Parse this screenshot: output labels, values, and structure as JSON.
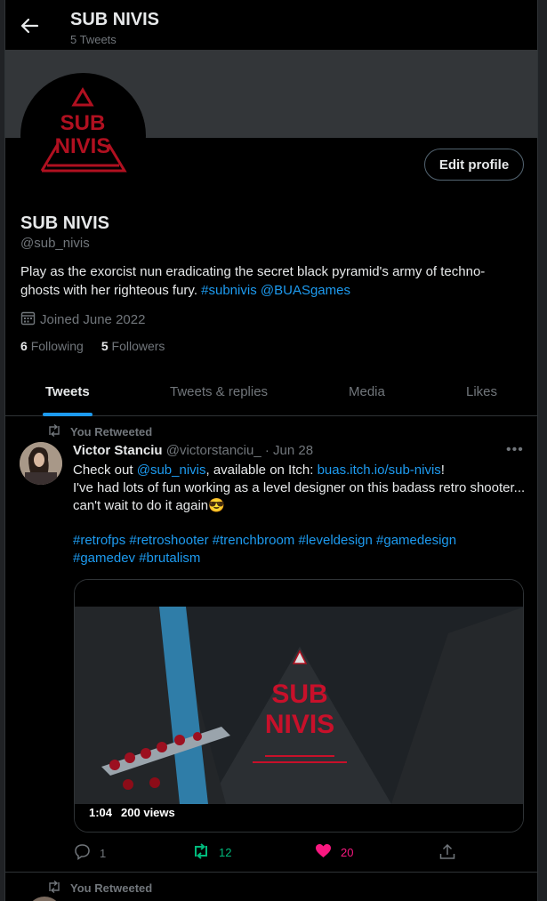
{
  "header": {
    "title": "SUB NIVIS",
    "subtitle": "5 Tweets"
  },
  "profile": {
    "avatar_text_line1": "SUB",
    "avatar_text_line2": "NIVIS",
    "edit_label": "Edit profile",
    "name": "SUB NIVIS",
    "handle": "@sub_nivis",
    "bio_text": "Play as the exorcist nun eradicating the secret black pyramid's army of techno-ghosts with her righteous fury. ",
    "bio_hashtag": "#subnivis",
    "bio_mention": "@BUASgames",
    "joined": "Joined June 2022",
    "following_count": "6",
    "following_label": "Following",
    "followers_count": "5",
    "followers_label": "Followers"
  },
  "tabs": [
    {
      "label": "Tweets",
      "active": true
    },
    {
      "label": "Tweets & replies",
      "active": false
    },
    {
      "label": "Media",
      "active": false
    },
    {
      "label": "Likes",
      "active": false
    }
  ],
  "tweets": [
    {
      "retweet_label": "You Retweeted",
      "author_name": "Victor Stanciu",
      "author_handle": "@victorstanciu_",
      "separator": " · ",
      "date": "Jun 28",
      "text_part1": "Check out ",
      "text_mention": "@sub_nivis",
      "text_part2": ", available on Itch: ",
      "text_link": "buas.itch.io/sub-nivis",
      "text_part3": "!",
      "text_line2": "I've had lots of fun working as a level designer on this badass retro shooter... can't wait to do it again",
      "text_emoji": "😎",
      "hashtags_line1": "#retrofps #retroshooter #trenchbroom #leveldesign #gamedesign",
      "hashtags_line2": "#gamedev #brutalism",
      "video_logo_line1": "SUB",
      "video_logo_line2": "NIVIS",
      "video_duration": "1:04",
      "video_views": "200 views",
      "replies": "1",
      "retweets": "12",
      "likes": "20"
    },
    {
      "retweet_label": "You Retweeted"
    }
  ],
  "colors": {
    "accent": "#1d9bf0",
    "retweet": "#00ba7c",
    "like": "#f91880",
    "brand_red": "#b01020"
  },
  "icons": [
    "back-arrow-icon",
    "calendar-icon",
    "retweet-icon",
    "more-icon",
    "reply-icon",
    "heart-icon",
    "share-icon",
    "smiling-face-with-sunglasses-icon"
  ]
}
